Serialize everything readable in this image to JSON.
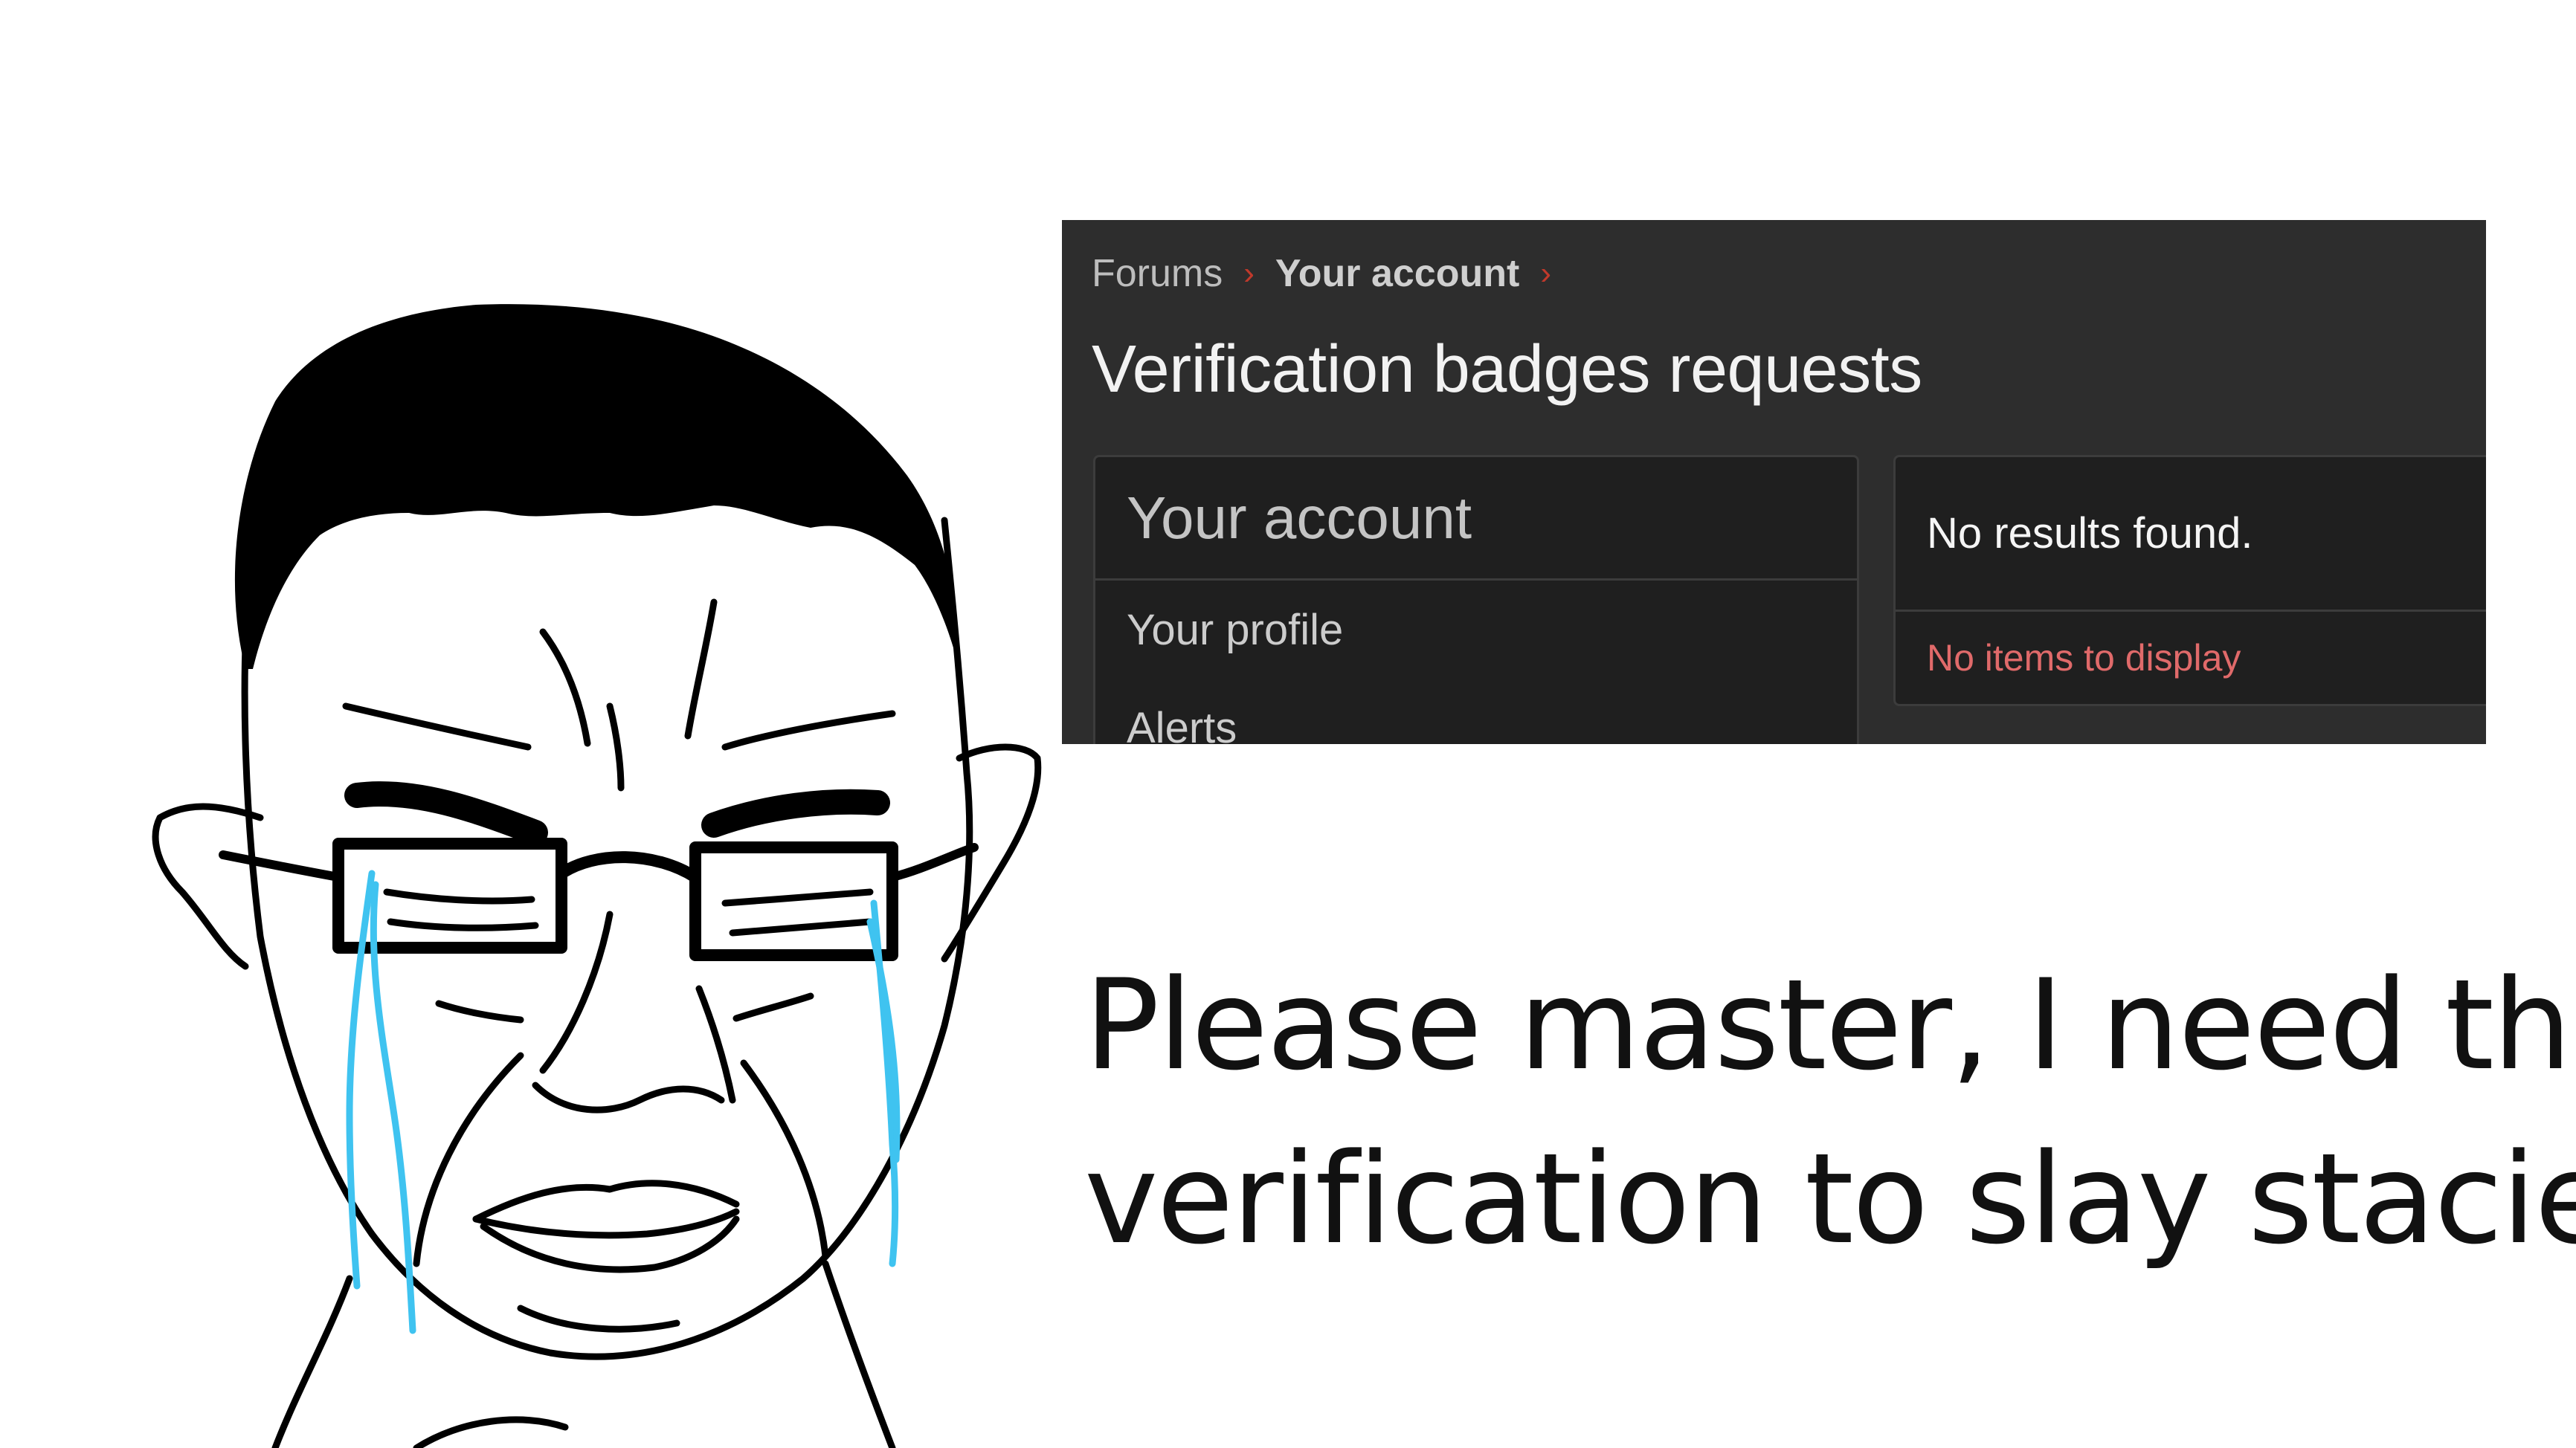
{
  "breadcrumb": {
    "items": [
      "Forums",
      "Your account"
    ],
    "separator": "›"
  },
  "page_title": "Verification badges requests",
  "account_panel": {
    "heading": "Your account",
    "items": [
      "Your profile",
      "Alerts"
    ]
  },
  "results_panel": {
    "message": "No results found.",
    "empty_text": "No items to display"
  },
  "caption": {
    "line1": "Please master, I need this",
    "line2": "verification to slay stacies"
  },
  "colors": {
    "forum_background": "#2d2d2d",
    "panel_background": "#1f1f1f",
    "separator_accent": "#c0392b",
    "empty_text": "#e06a6a",
    "tears": "#3fc3f0"
  },
  "icons": {
    "breadcrumb_separator": "chevron-right-icon"
  }
}
